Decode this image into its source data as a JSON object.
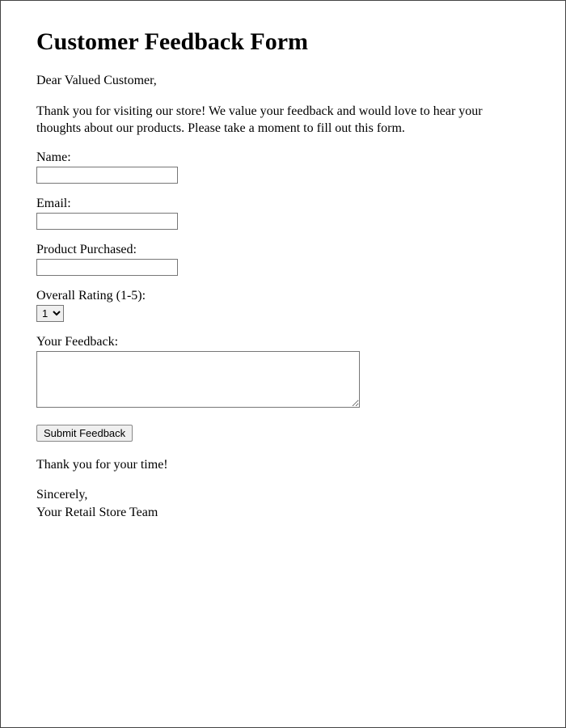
{
  "title": "Customer Feedback Form",
  "greeting": "Dear Valued Customer,",
  "intro": "Thank you for visiting our store! We value your feedback and would love to hear your thoughts about our products. Please take a moment to fill out this form.",
  "fields": {
    "name": {
      "label": "Name:",
      "value": ""
    },
    "email": {
      "label": "Email:",
      "value": ""
    },
    "product": {
      "label": "Product Purchased:",
      "value": ""
    },
    "rating": {
      "label": "Overall Rating (1-5):",
      "selected": "1"
    },
    "feedback": {
      "label": "Your Feedback:",
      "value": ""
    }
  },
  "submit_label": "Submit Feedback",
  "thankyou": "Thank you for your time!",
  "signoff_line1": "Sincerely,",
  "signoff_line2": "Your Retail Store Team"
}
